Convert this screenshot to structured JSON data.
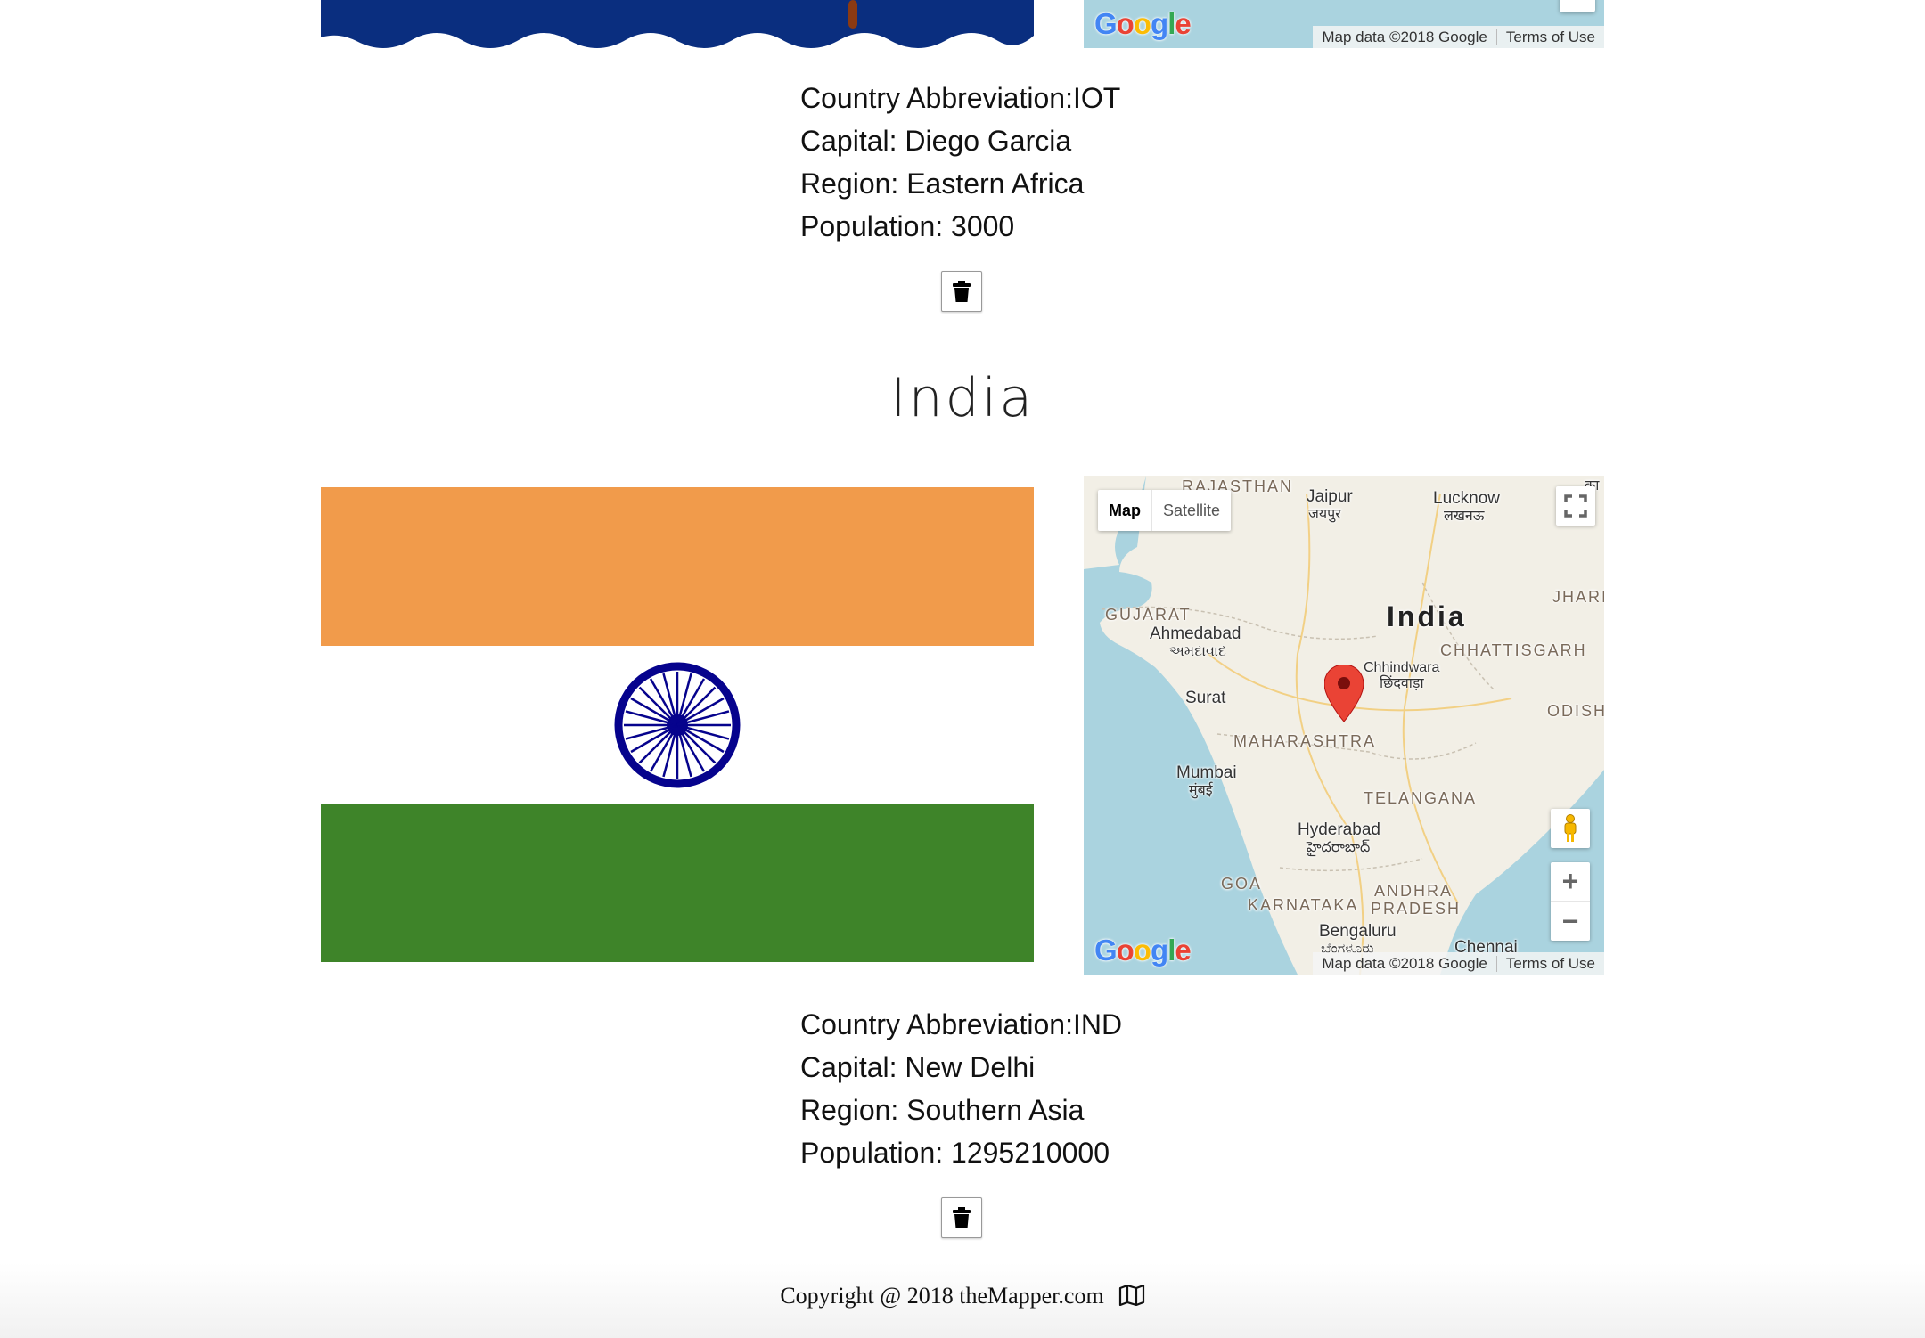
{
  "upper_card": {
    "abbreviation": "Country Abbreviation:IOT",
    "capital": "Capital: Diego Garcia",
    "region": "Region: Eastern Africa",
    "population": "Population: 3000"
  },
  "india_card": {
    "title": "India",
    "abbreviation": "Country Abbreviation:IND",
    "capital": "Capital: New Delhi",
    "region": "Region: Southern Asia",
    "population": "Population: 1295210000"
  },
  "map": {
    "logo": "Google",
    "attribution": "Map data ©2018 Google",
    "terms": "Terms of Use",
    "type_map": "Map",
    "type_satellite": "Satellite",
    "zoom_in": "+",
    "zoom_out": "−",
    "labels": {
      "rajasthan": "RAJASTHAN",
      "jaipur": "Jaipur",
      "jaipur_local": "जयपुर",
      "lucknow": "Lucknow",
      "lucknow_local": "लखनऊ",
      "gujarat": "GUJARAT",
      "ahmedabad": "Ahmedabad",
      "ahmedabad_local": "અમદાવાદ",
      "india": "India",
      "chhattisgarh": "CHHATTISGARH",
      "jharkhand": "JHARI",
      "chhindwara": "Chhindwara",
      "chhindwara_local": "छिंदवाड़ा",
      "surat": "Surat",
      "odisha": "ODISH",
      "maharashtra": "MAHARASHTRA",
      "mumbai": "Mumbai",
      "mumbai_local": "मुंबई",
      "telangana": "TELANGANA",
      "hyderabad": "Hyderabad",
      "hyderabad_local": "హైదరాబాద్",
      "goa": "GOA",
      "andhra": "ANDHRA",
      "karnataka": "KARNATAKA",
      "pradesh": "PRADESH",
      "bengaluru": "Bengaluru",
      "bengaluru_local": "ಬೆಂಗಳೂರು",
      "chennai": "Chennai",
      "kanpur_partial": "का"
    },
    "colors": {
      "water": "#aad3df",
      "land": "#f2efe6",
      "marker": "#ea4335"
    }
  },
  "flag_colors": {
    "saffron": "#f19b4b",
    "white": "#ffffff",
    "green": "#3e8429",
    "chakra": "#06038d",
    "biot_blue": "#0a2e7f"
  },
  "footer": {
    "text": "Copyright @ 2018 theMapper.com"
  },
  "icons": {
    "delete": "trash-icon",
    "footer": "map-book-icon",
    "fullscreen": "fullscreen-icon",
    "pegman": "pegman-icon",
    "marker": "map-marker-icon"
  }
}
